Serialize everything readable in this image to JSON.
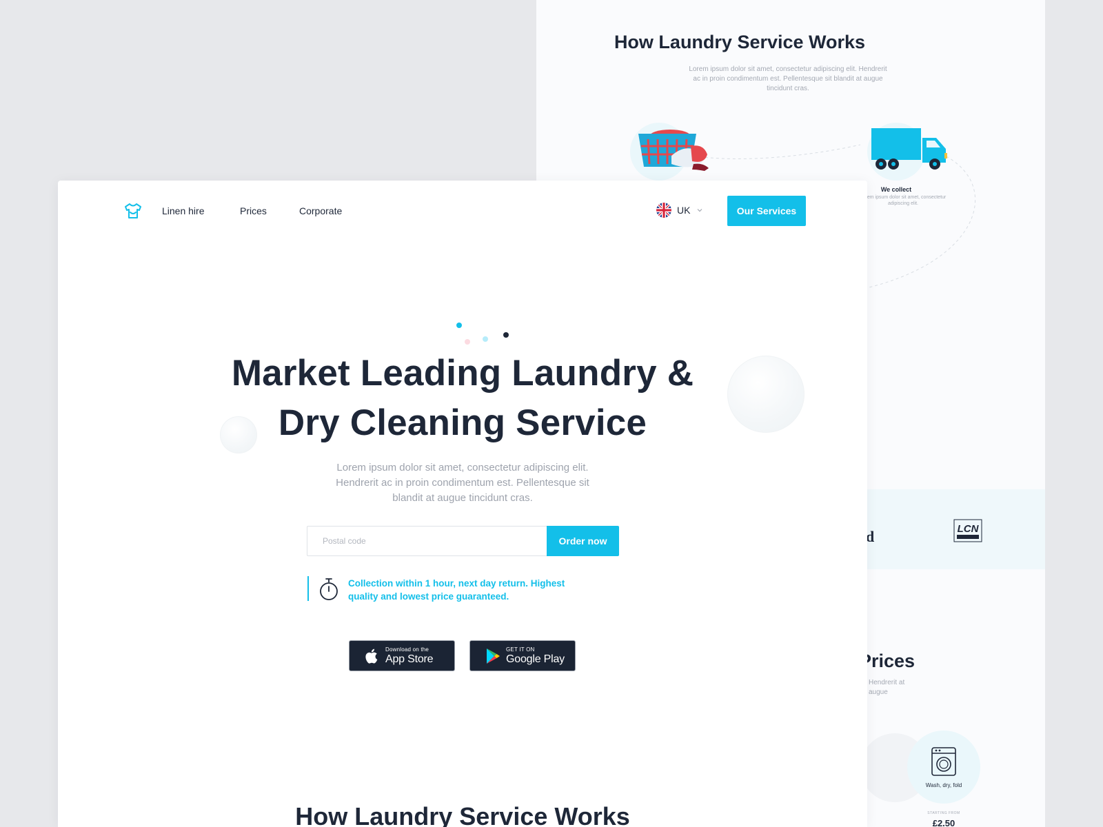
{
  "background_page": {
    "how_title": "How Laundry Service Works",
    "how_subtitle": "Lorem ipsum dolor sit amet, consectetur adipiscing elit. Hendrerit ac in proin condimentum est. Pellentesque sit blandit at augue tincidunt cras.",
    "step_collect": {
      "title": "We collect",
      "text": "Lorem ipsum dolor sit amet, consectetur adipiscing elit."
    },
    "partner_logo_fragment": "d",
    "partner_badge": "LCN AWARDS",
    "prices_title_fragment": "Prices",
    "prices_subtitle_fragment": "Hendrerit at augue",
    "service_wash": {
      "label": "Wash, dry, fold",
      "starting_from": "STARTING FROM",
      "price": "£2.50"
    }
  },
  "nav": {
    "logo_icon": "tshirt-logo-icon",
    "links": [
      "Linen hire",
      "Prices",
      "Corporate"
    ],
    "language": "UK",
    "language_flag": "uk-flag-icon",
    "cta": "Our Services"
  },
  "hero": {
    "title_line1": "Market Leading Laundry &",
    "title_line2": "Dry Cleaning Service",
    "subtitle_line1": "Lorem ipsum dolor sit amet, consectetur adipiscing elit.",
    "subtitle_line2": "Hendrerit ac in proin condimentum est. Pellentesque sit",
    "subtitle_line3": "blandit at augue tincidunt cras.",
    "postal_placeholder": "Postal code",
    "order_button": "Order now",
    "guarantee_line1": "Collection within 1 hour, next day return. Highest",
    "guarantee_line2": "quality and lowest price guaranteed."
  },
  "stores": {
    "apple": {
      "small": "Download on the",
      "big": "App Store"
    },
    "google": {
      "small": "GET IT ON",
      "big": "Google Play"
    }
  },
  "section": {
    "how_title": "How Laundry Service Works"
  },
  "colors": {
    "accent": "#13bfe9",
    "heading": "#1e2738",
    "muted": "#9ea3ad"
  }
}
